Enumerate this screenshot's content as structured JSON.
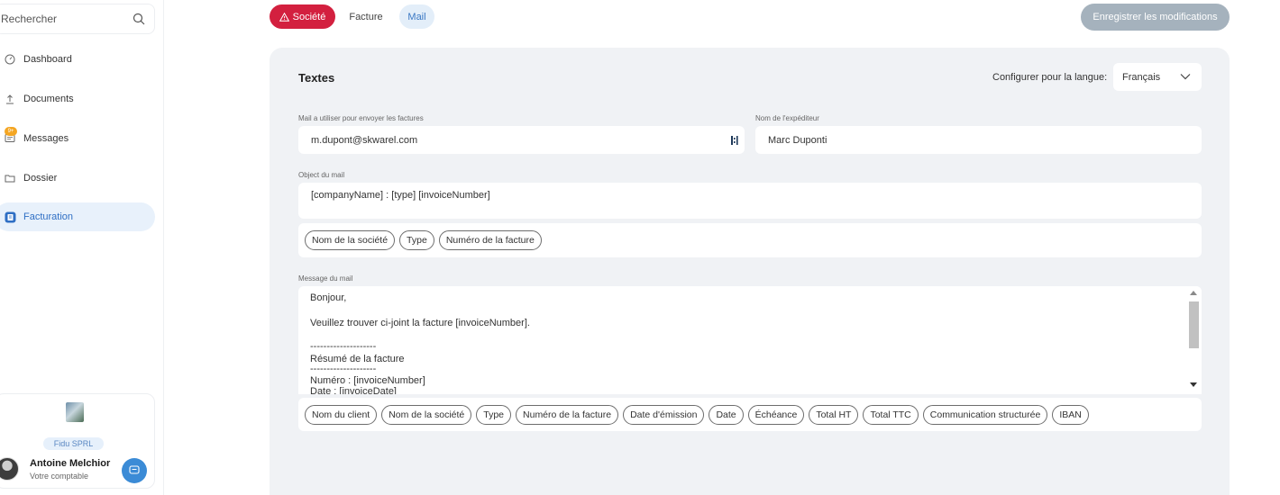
{
  "sidebar": {
    "search_placeholder": "Rechercher",
    "items": [
      {
        "label": "Dashboard",
        "icon": "dashboard-icon"
      },
      {
        "label": "Documents",
        "icon": "upload-icon"
      },
      {
        "label": "Messages",
        "icon": "message-icon",
        "badge": "9+"
      },
      {
        "label": "Dossier",
        "icon": "folder-icon"
      },
      {
        "label": "Facturation",
        "icon": "invoice-icon",
        "active": true
      }
    ],
    "profile": {
      "company": "Fidu SPRL",
      "name": "Antoine Melchior",
      "role": "Votre comptable"
    }
  },
  "tabs": [
    {
      "label": "Société",
      "state": "error"
    },
    {
      "label": "Facture",
      "state": "default"
    },
    {
      "label": "Mail",
      "state": "selected"
    }
  ],
  "save_label": "Enregistrer les modifications",
  "panel": {
    "title": "Textes",
    "lang_label": "Configurer pour la langue:",
    "lang_value": "Français",
    "email": {
      "label": "Mail a utiliser pour envoyer les factures",
      "value": "m.dupont@skwarel.com"
    },
    "sender": {
      "label": "Nom de l'expéditeur",
      "value": "Marc Duponti"
    },
    "subject": {
      "label": "Object du mail",
      "value": "[companyName] : [type] [invoiceNumber]",
      "chips": [
        "Nom de la société",
        "Type",
        "Numéro de la facture"
      ]
    },
    "message": {
      "label": "Message du mail",
      "lines": [
        "Bonjour,",
        "",
        "Veuillez trouver ci-joint la facture [invoiceNumber].",
        "",
        "--------------------",
        "Résumé de la facture",
        "--------------------",
        "Numéro : [invoiceNumber]",
        "Date : [invoiceDate]"
      ],
      "chips": [
        "Nom du client",
        "Nom de la société",
        "Type",
        "Numéro de la facture",
        "Date d'émission",
        "Date",
        "Échéance",
        "Total HT",
        "Total TTC",
        "Communication structurée",
        "IBAN"
      ]
    }
  },
  "colors": {
    "accent": "#3b8bd6",
    "error_tab": "#d3203f",
    "save_disabled": "#a5b2bd",
    "panel_bg": "#f0f2f5"
  }
}
